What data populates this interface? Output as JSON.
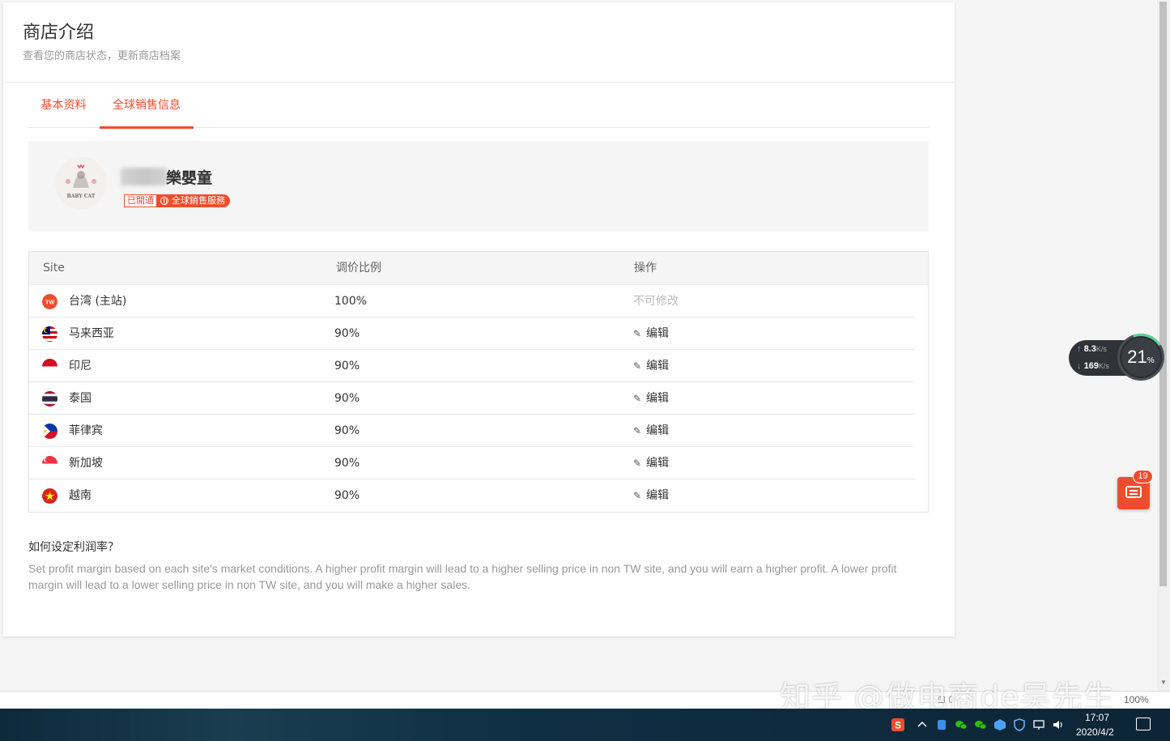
{
  "header": {
    "title": "商店介绍",
    "subtitle": "查看您的商店状态，更新商店档案"
  },
  "tabs": [
    {
      "label": "基本资料",
      "active": false
    },
    {
      "label": "全球销售信息",
      "active": true
    }
  ],
  "shop": {
    "name": "樂嬰童",
    "badge_open": "已開通",
    "badge_service": "全球銷售服務",
    "logo_text": "BABY CAT"
  },
  "table": {
    "headers": [
      "Site",
      "调价比例",
      "操作"
    ],
    "rows": [
      {
        "site": "台湾 (主站)",
        "flag": "tw-icon",
        "ratio": "100%",
        "action": "不可修改",
        "editable": false
      },
      {
        "site": "马来西亚",
        "flag": "malaysia-flag-icon",
        "ratio": "90%",
        "action": "编辑",
        "editable": true
      },
      {
        "site": "印尼",
        "flag": "indonesia-flag-icon",
        "ratio": "90%",
        "action": "编辑",
        "editable": true
      },
      {
        "site": "泰国",
        "flag": "thailand-flag-icon",
        "ratio": "90%",
        "action": "编辑",
        "editable": true
      },
      {
        "site": "菲律宾",
        "flag": "philippines-flag-icon",
        "ratio": "90%",
        "action": "编辑",
        "editable": true
      },
      {
        "site": "新加坡",
        "flag": "singapore-flag-icon",
        "ratio": "90%",
        "action": "编辑",
        "editable": true
      },
      {
        "site": "越南",
        "flag": "vietnam-flag-icon",
        "ratio": "90%",
        "action": "编辑",
        "editable": true
      }
    ]
  },
  "help": {
    "title": "如何设定利润率？",
    "text": "Set profit margin based on each site's market conditions. A higher profit margin will lead to a higher selling price in non TW site, and you will earn a higher profit. A lower profit margin will lead to a lower selling price in non TW site, and you will make a higher sales."
  },
  "network_widget": {
    "upload": "8.3",
    "download": "169",
    "unit": "K/s",
    "percent": "21",
    "percent_sign": "%"
  },
  "chat": {
    "count": "19"
  },
  "statusbar": {
    "zoom": "100%",
    "misc": "⊞ 0"
  },
  "watermark": "知乎 @做电商de吴先生",
  "taskbar": {
    "time": "17:07",
    "date": "2020/4/2"
  },
  "colors": {
    "accent": "#ee4d2d",
    "muted_text": "#999999",
    "panel_bg": "#f5f5f5"
  }
}
